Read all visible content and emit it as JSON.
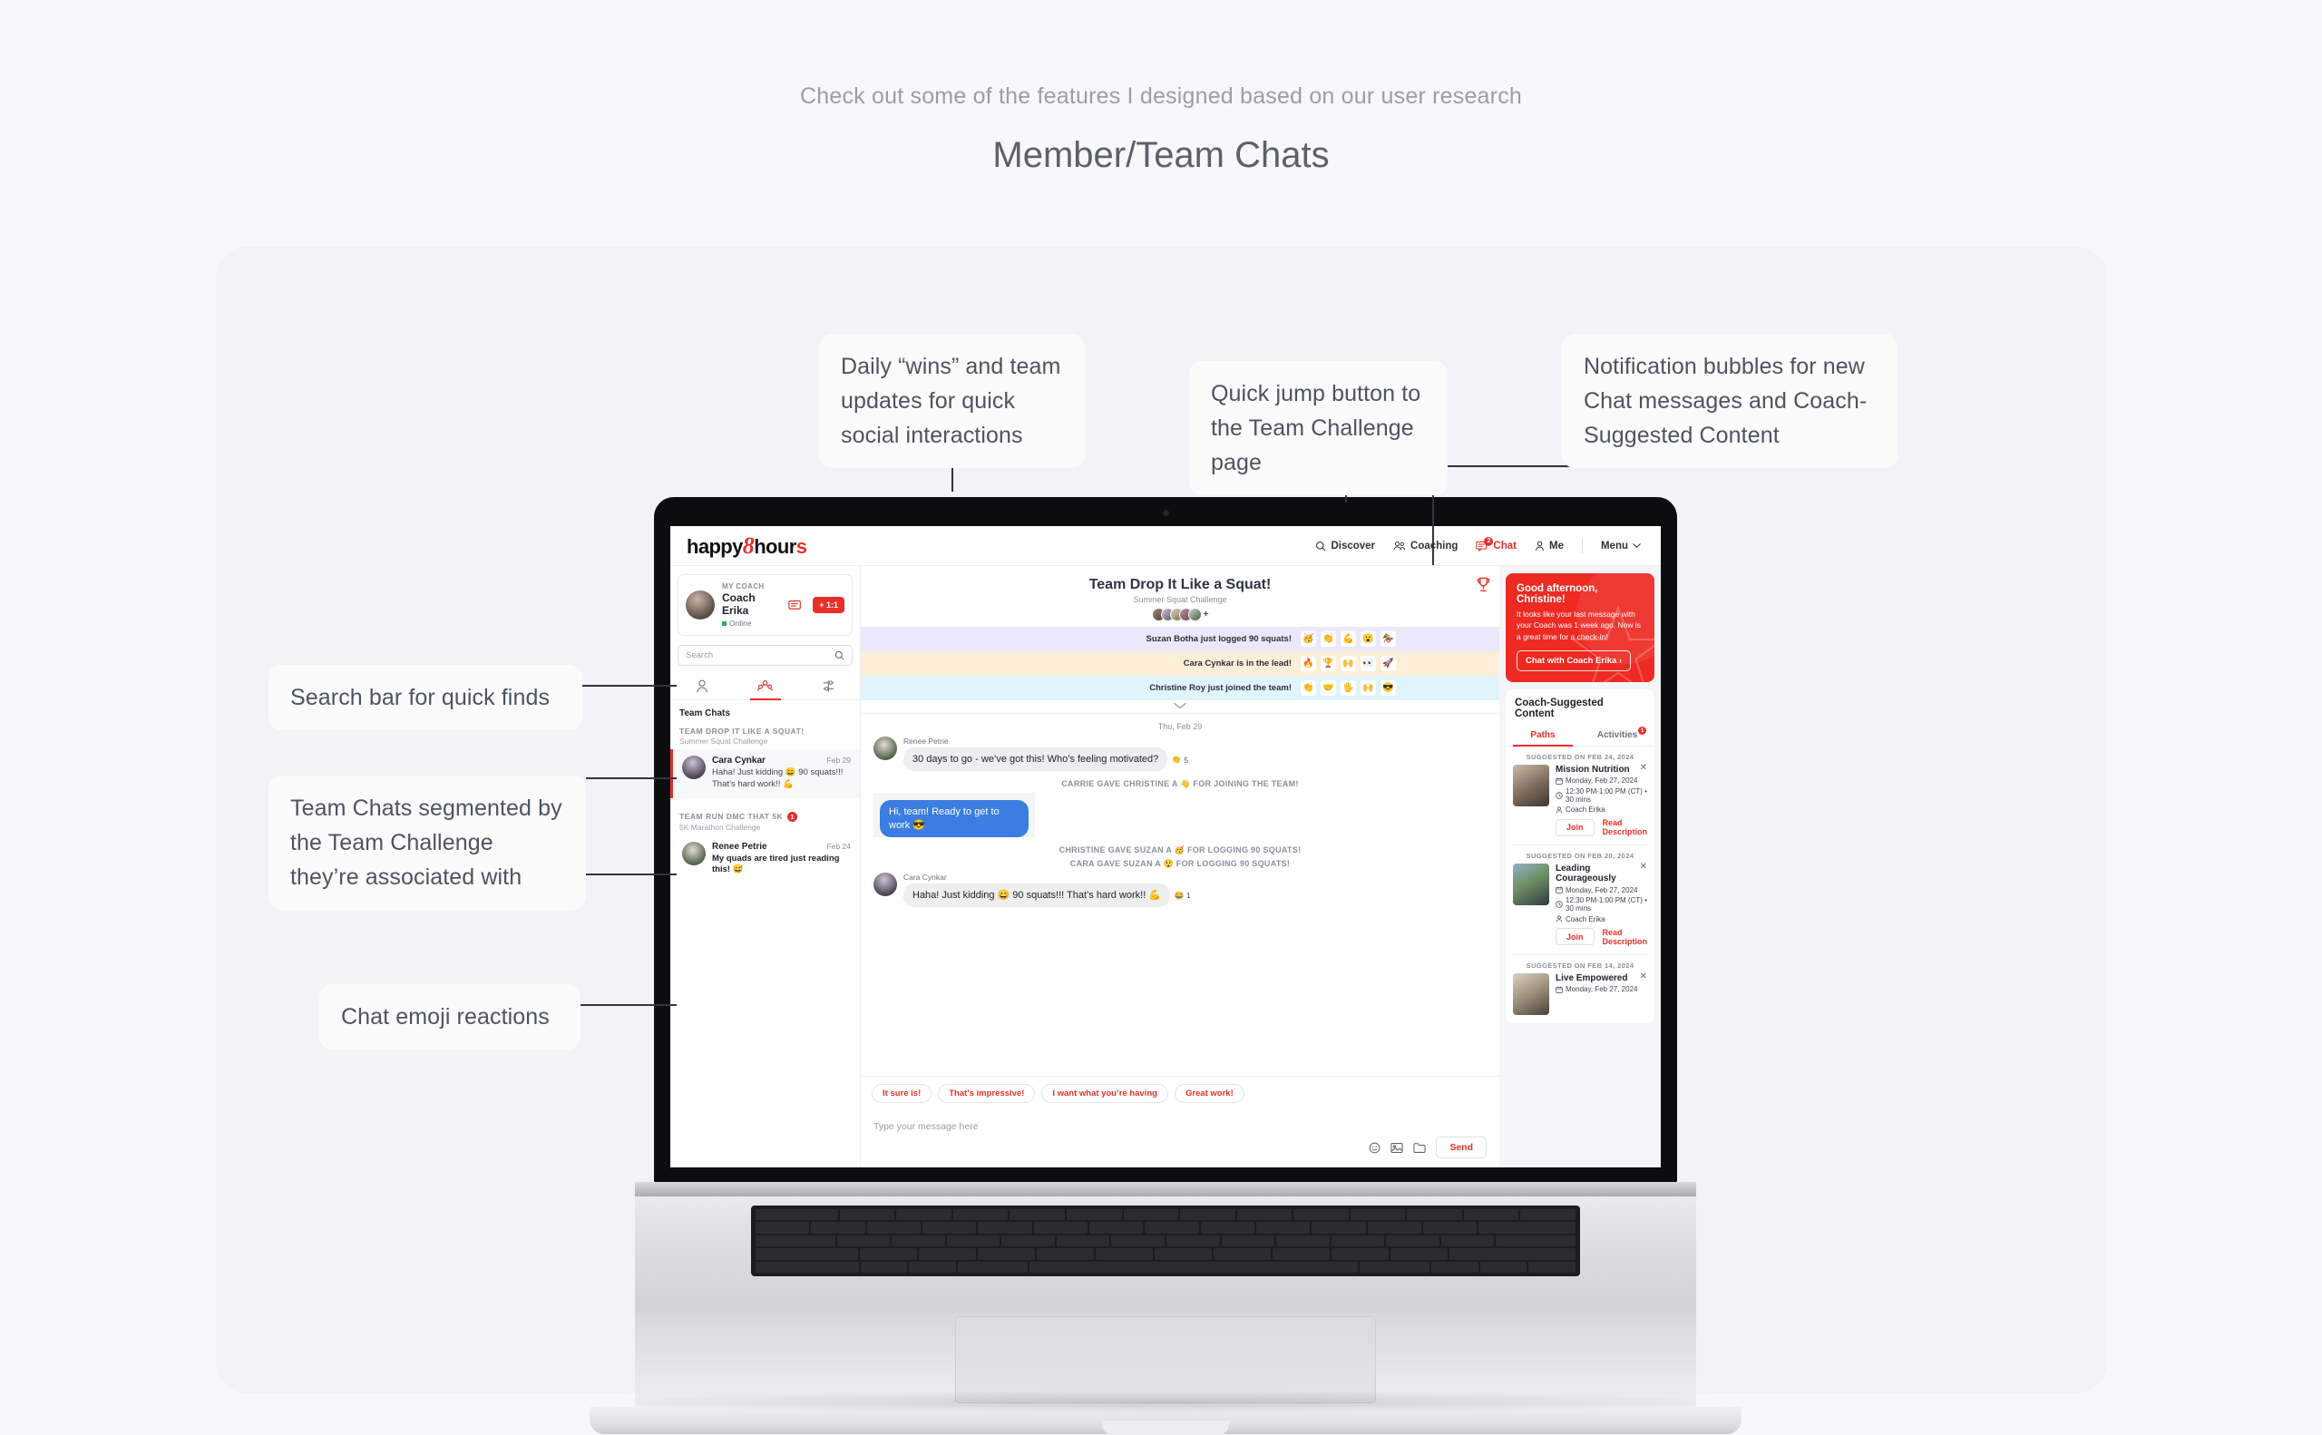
{
  "page": {
    "kicker": "Check out some of the features I designed based on our user research",
    "title": "Member/Team Chats"
  },
  "annotations": [
    {
      "id": "daily-wins",
      "text": "Daily “wins” and team updates for quick social interactions"
    },
    {
      "id": "quick-jump",
      "text": "Quick jump button to the Team Challenge page"
    },
    {
      "id": "notification-bubbles",
      "text": "Notification bubbles for new Chat messages and Coach-Suggested Content"
    },
    {
      "id": "search-bar",
      "text": "Search bar for quick finds"
    },
    {
      "id": "team-chats-segmented",
      "text": "Team Chats segmented by the Team Challenge they’re associated with"
    },
    {
      "id": "chat-emoji-reactions",
      "text": "Chat emoji reactions"
    }
  ],
  "app": {
    "logo": {
      "part1": "happy",
      "eight": "8",
      "part2": "hour",
      "tail": "s"
    },
    "nav": [
      {
        "label": "Discover",
        "icon": "search-icon",
        "active": false,
        "badge": ""
      },
      {
        "label": "Coaching",
        "icon": "people-icon",
        "active": false,
        "badge": ""
      },
      {
        "label": "Chat",
        "icon": "chat-icon",
        "active": true,
        "badge": "2"
      },
      {
        "label": "Me",
        "icon": "person-icon",
        "active": false,
        "badge": ""
      },
      {
        "label": "Menu",
        "icon": "chevron-down-icon",
        "active": false,
        "badge": ""
      }
    ]
  },
  "sidebar": {
    "coach": {
      "label": "MY COACH",
      "name": "Coach Erika",
      "status": "Online",
      "chip": "+ 1:1"
    },
    "search": {
      "placeholder": "Search",
      "value": ""
    },
    "tabs": [
      {
        "icon": "person-icon",
        "name": "member-chats",
        "active": false
      },
      {
        "icon": "group-icon",
        "name": "team-chats",
        "active": true
      },
      {
        "icon": "filter-icon",
        "name": "filter",
        "active": false
      }
    ],
    "list_heading": "Team Chats",
    "groups": [
      {
        "title": "TEAM DROP IT LIKE A SQUAT!",
        "subtitle": "Summer Squat Challenge",
        "badge": "",
        "rows": [
          {
            "name": "Cara Cynkar",
            "date": "Feb 29",
            "preview": "Haha! Just kidding 😄 90 squats!!! That’s hard work!! 💪",
            "unread": false,
            "active": true
          }
        ]
      },
      {
        "title": "TEAM RUN DMC THAT 5K",
        "subtitle": "5K Marathon Challenge",
        "badge": "1",
        "rows": [
          {
            "name": "Renee Petrie",
            "date": "Feb 24",
            "preview": "My quads are tired just reading this! 😅",
            "unread": true,
            "active": false
          }
        ]
      }
    ]
  },
  "conversation": {
    "title": "Team Drop It Like a Squat!",
    "subtitle": "Summer Squat Challenge",
    "members_plus": "+",
    "trophy_icon": "trophy-icon",
    "banners": [
      {
        "text": "Suzan Botha just logged 90 squats!",
        "bg": "#ebe8fb",
        "emojis": [
          "🥳",
          "👏",
          "💪",
          "😮",
          "🏇"
        ]
      },
      {
        "text": "Cara Cynkar is in the lead!",
        "bg": "#fdeed7",
        "emojis": [
          "🔥",
          "🏆",
          "🙌",
          "👀",
          "🚀"
        ]
      },
      {
        "text": "Christine Roy just joined the team!",
        "bg": "#e0f5fb",
        "emojis": [
          "👏",
          "🤝",
          "🖐️",
          "🙌",
          "😎"
        ]
      }
    ],
    "day_separator": "Thu, Feb 29",
    "messages": [
      {
        "kind": "incoming",
        "author": "Renee Petrie",
        "avatar": "av-renee",
        "text": "30 days to go - we’ve got this! Who’s feeling motivated?",
        "reaction_emoji": "👏",
        "reaction_count": "5"
      },
      {
        "kind": "system",
        "text": "CARRIE GAVE CHRISTINE A 👋 FOR JOINING THE TEAM!"
      },
      {
        "kind": "outgoing",
        "text": "Hi, team! Ready to get to work 😎"
      },
      {
        "kind": "system",
        "text": "CHRISTINE GAVE SUZAN A 🥳 FOR LOGGING 90 SQUATS!"
      },
      {
        "kind": "system",
        "text": "CARA GAVE SUZAN A 😲 FOR LOGGING 90 SQUATS!"
      },
      {
        "kind": "incoming",
        "author": "Cara Cynkar",
        "avatar": "av-cara",
        "text": "Haha! Just kidding 😄 90 squats!!! That’s hard work!! 💪",
        "reaction_emoji": "😂",
        "reaction_count": "1"
      }
    ],
    "quick_replies": [
      "It sure is!",
      "That’s impressive!",
      "I want what you’re having",
      "Great work!"
    ],
    "composer": {
      "placeholder": "Type your message here",
      "value": "",
      "tools": [
        "emoji-icon",
        "image-icon",
        "folder-icon"
      ],
      "send_label": "Send"
    }
  },
  "right_panel": {
    "promo": {
      "title": "Good afternoon, Christine!",
      "text": "It looks like your last message with your Coach was 1 week ago. Now is a great time for a check-in!",
      "button": "Chat with Coach Erika ›",
      "bg": "#ee2a22"
    },
    "suggested": {
      "heading": "Coach-Suggested Content",
      "tabs": [
        {
          "label": "Paths",
          "active": true,
          "badge": ""
        },
        {
          "label": "Activities",
          "active": false,
          "badge": "1"
        }
      ],
      "cards": [
        {
          "suggested_on": "SUGGESTED ON FEB 24, 2024",
          "title": "Mission Nutrition",
          "date": "Monday, Feb 27, 2024",
          "time": "12:30 PM-1:00 PM (CT) • 30 mins",
          "coach": "Coach Erika",
          "join_label": "Join",
          "read_label": "Read Description",
          "thumb": "th1"
        },
        {
          "suggested_on": "SUGGESTED ON FEB 20, 2024",
          "title": "Leading Courageously",
          "date": "Monday, Feb 27, 2024",
          "time": "12:30 PM-1:00 PM (CT) • 30 mins",
          "coach": "Coach Erika",
          "join_label": "Join",
          "read_label": "Read Description",
          "thumb": "th2"
        },
        {
          "suggested_on": "SUGGESTED ON FEB 14, 2024",
          "title": "Live Empowered",
          "date": "Monday, Feb 27, 2024",
          "time": "",
          "coach": "",
          "join_label": "",
          "read_label": "",
          "thumb": "th3"
        }
      ]
    }
  }
}
